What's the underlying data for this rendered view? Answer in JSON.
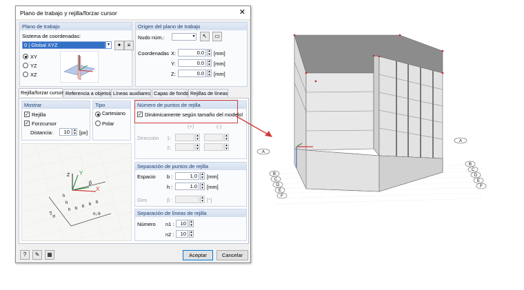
{
  "dialog": {
    "title": "Plano de trabajo y rejilla/forzar cursor",
    "close_glyph": "✕",
    "plano": {
      "header": "Plano de trabajo",
      "sistema_label": "Sistema de coordenadas:",
      "sistema_value": "0 | Global XYZ",
      "options": [
        "XY",
        "YZ",
        "XZ"
      ],
      "selected": "XY"
    },
    "origen": {
      "header": "Origen del plano de trabajo",
      "nudo_label": "Nudo núm.:",
      "coord_label": "Coordenadas",
      "axes": [
        {
          "axis": "X:",
          "value": "0.0",
          "unit": "[mm]"
        },
        {
          "axis": "Y:",
          "value": "0.0",
          "unit": "[mm]"
        },
        {
          "axis": "Z:",
          "value": "0.0",
          "unit": "[mm]"
        }
      ]
    },
    "tabs": [
      "Rejilla/forzar cursor",
      "Referencia a objetos",
      "Líneas auxiliares",
      "Capas de fondo",
      "Rejillas de líneas"
    ],
    "mostrar": {
      "header": "Mostrar",
      "rejilla": "Rejilla",
      "forzcursor": "Forzcursor",
      "distancia_label": "Distancia:",
      "distancia_value": "10",
      "distancia_unit": "[px]"
    },
    "tipo": {
      "header": "Tipo",
      "options": [
        "Cartesiano",
        "Polar"
      ],
      "selected": "Cartesiano"
    },
    "numero": {
      "header": "Número de puntos de rejilla",
      "dinamico": "Dinámicamente según tamaño del modelo!",
      "plus": "(+)",
      "minus": "(-)",
      "direccion": "Dirección",
      "one": "1:",
      "two": "2:"
    },
    "sep_puntos": {
      "header": "Separación de puntos de rejilla",
      "espacio": "Espacio",
      "b_label": "b :",
      "b_value": "1.0",
      "h_label": "h :",
      "h_value": "1.0",
      "unit": "[mm]",
      "giro": "Giro",
      "beta": "β :",
      "deg": "[°]"
    },
    "sep_lineas": {
      "header": "Separación de líneas de rejilla",
      "numero": "Número",
      "n1_label": "n1 :",
      "n1_value": "10",
      "n2_label": "n2 :",
      "n2_value": "10"
    },
    "diagram_labels": [
      "Y",
      "X",
      "Z",
      "β",
      "b",
      "b",
      "b",
      "b",
      "n₁·b",
      "n₂·h",
      "h",
      "h",
      "h"
    ],
    "buttons": {
      "ok": "Aceptar",
      "cancel": "Cancelar"
    }
  },
  "model": {
    "axis_labels": [
      "A",
      "A",
      "B",
      "C",
      "D",
      "E",
      "F",
      "B",
      "C",
      "D",
      "E",
      "F"
    ],
    "colors": {
      "arrow": "#d23b3b",
      "building_top": "#888888",
      "building_side": "#e6e6e6",
      "building_front": "#d3d3d3"
    }
  }
}
